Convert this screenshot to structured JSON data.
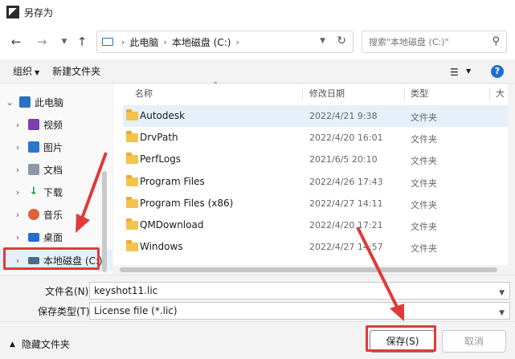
{
  "window": {
    "title": "另存为"
  },
  "address": {
    "crumbs": [
      "此电脑",
      "本地磁盘 (C:)"
    ]
  },
  "search": {
    "placeholder": "搜索\"本地磁盘 (C:)\""
  },
  "toolbar": {
    "organize": "组织",
    "new_folder": "新建文件夹"
  },
  "sidebar": {
    "items": [
      {
        "label": "此电脑",
        "icon": "pc-icon",
        "color": "#2c6fbf"
      },
      {
        "label": "视频",
        "icon": "video-icon",
        "color": "#7a3fb0"
      },
      {
        "label": "图片",
        "icon": "pictures-icon",
        "color": "#2a78c8"
      },
      {
        "label": "文档",
        "icon": "documents-icon",
        "color": "#8a98a8"
      },
      {
        "label": "下载",
        "icon": "download-icon",
        "color": "#2a9a3a"
      },
      {
        "label": "音乐",
        "icon": "music-icon",
        "color": "#e0603a"
      },
      {
        "label": "桌面",
        "icon": "desktop-icon",
        "color": "#1f6fd0"
      },
      {
        "label": "本地磁盘 (C:)",
        "icon": "drive-icon",
        "color": "#4a6a8a"
      }
    ]
  },
  "columns": {
    "name": "名称",
    "modified": "修改日期",
    "type": "类型",
    "size": "大"
  },
  "files": [
    {
      "name": "Autodesk",
      "modified": "2022/4/21 9:38",
      "type": "文件夹"
    },
    {
      "name": "DrvPath",
      "modified": "2022/4/20 16:01",
      "type": "文件夹"
    },
    {
      "name": "PerfLogs",
      "modified": "2021/6/5 20:10",
      "type": "文件夹"
    },
    {
      "name": "Program Files",
      "modified": "2022/4/26 17:43",
      "type": "文件夹"
    },
    {
      "name": "Program Files (x86)",
      "modified": "2022/4/27 14:11",
      "type": "文件夹"
    },
    {
      "name": "QMDownload",
      "modified": "2022/4/20 17:21",
      "type": "文件夹"
    },
    {
      "name": "Windows",
      "modified": "2022/4/27 14:57",
      "type": "文件夹"
    }
  ],
  "form": {
    "filename_label": "文件名(N):",
    "filename_value": "keyshot11.lic",
    "filetype_label": "保存类型(T):",
    "filetype_value": "License file (*.lic)"
  },
  "footer": {
    "hide_folders": "隐藏文件夹",
    "save": "保存(S)",
    "cancel": "取消"
  },
  "colors": {
    "accent": "#1f6fd0",
    "annotation": "#e03a3a",
    "selected_row": "#e5f0fb"
  }
}
